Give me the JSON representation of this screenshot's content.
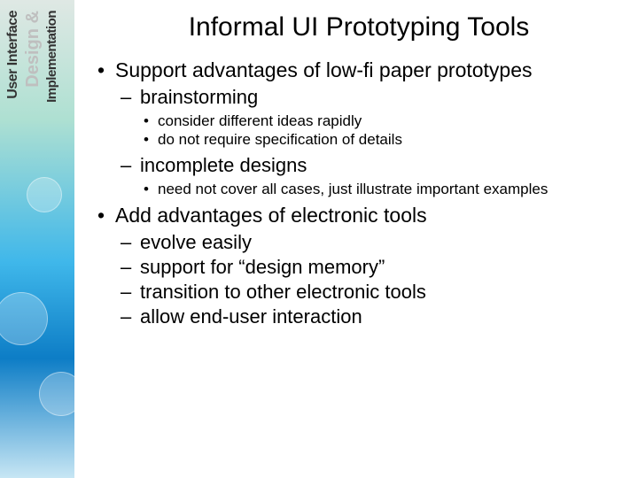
{
  "sidebar": {
    "label1": "User Interface",
    "label2": "Design &",
    "label3": "Implementation"
  },
  "title": "Informal UI Prototyping Tools",
  "bullets": [
    {
      "text": "Support advantages of low-fi paper prototypes",
      "children": [
        {
          "text": "brainstorming",
          "children": [
            {
              "text": "consider different ideas rapidly"
            },
            {
              "text": "do not require specification of details"
            }
          ]
        },
        {
          "text": "incomplete designs",
          "children": [
            {
              "text": "need not cover all cases, just illustrate important examples"
            }
          ]
        }
      ]
    },
    {
      "text": "Add advantages of electronic tools",
      "children": [
        {
          "text": "evolve easily"
        },
        {
          "text": "support for “design memory”"
        },
        {
          "text": "transition to other electronic tools"
        },
        {
          "text": "allow end-user interaction"
        }
      ]
    }
  ]
}
